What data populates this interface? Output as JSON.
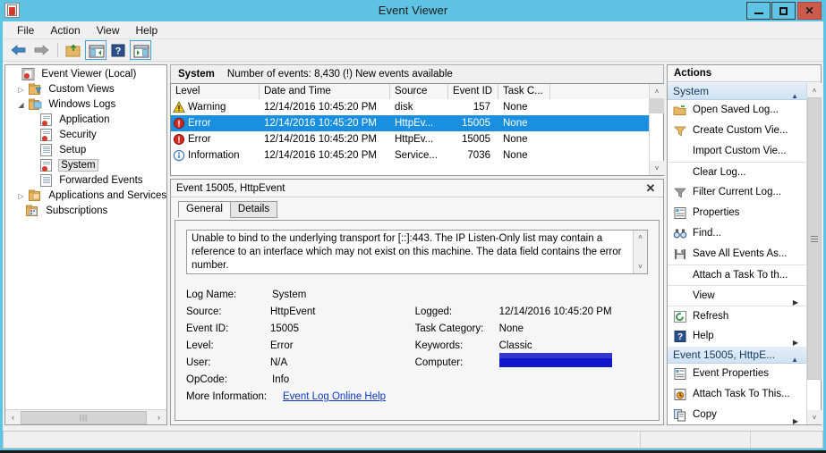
{
  "window": {
    "title": "Event Viewer",
    "icon": "event-viewer-icon",
    "minimize": "—",
    "maximize": "□",
    "close": "✕"
  },
  "menu": {
    "items": [
      {
        "label": "File"
      },
      {
        "label": "Action"
      },
      {
        "label": "View"
      },
      {
        "label": "Help"
      }
    ]
  },
  "toolbar": {
    "buttons": [
      {
        "name": "back-button",
        "icon": "left-arrow-icon"
      },
      {
        "name": "forward-button",
        "icon": "right-arrow-icon"
      },
      {
        "name": "up-one-level-button",
        "icon": "folder-up-icon"
      },
      {
        "name": "show-hide-console-tree-button",
        "icon": "console-tree-icon"
      },
      {
        "name": "help-button",
        "icon": "question-mark-icon"
      },
      {
        "name": "show-hide-action-pane-button",
        "icon": "action-pane-icon"
      }
    ]
  },
  "tree": {
    "nodes": [
      {
        "label": "Event Viewer (Local)",
        "indent": 0,
        "expander": "",
        "icon": "event-viewer-icon",
        "selected": false
      },
      {
        "label": "Custom Views",
        "indent": 1,
        "expander": "▷",
        "icon": "custom-views-icon",
        "selected": false
      },
      {
        "label": "Windows Logs",
        "indent": 1,
        "expander": "◢",
        "icon": "windows-logs-icon",
        "selected": false
      },
      {
        "label": "Application",
        "indent": 2,
        "expander": "",
        "icon": "log-alert-icon",
        "selected": false
      },
      {
        "label": "Security",
        "indent": 2,
        "expander": "",
        "icon": "log-alert-icon",
        "selected": false
      },
      {
        "label": "Setup",
        "indent": 2,
        "expander": "",
        "icon": "log-icon",
        "selected": false
      },
      {
        "label": "System",
        "indent": 2,
        "expander": "",
        "icon": "log-alert-icon",
        "selected": true
      },
      {
        "label": "Forwarded Events",
        "indent": 2,
        "expander": "",
        "icon": "log-icon",
        "selected": false
      },
      {
        "label": "Applications and Services Lo",
        "indent": 1,
        "expander": "▷",
        "icon": "folder-icon",
        "selected": false
      },
      {
        "label": "Subscriptions",
        "indent": 1,
        "expander": "",
        "icon": "subscriptions-icon",
        "selected": false
      }
    ]
  },
  "log": {
    "name": "System",
    "status": "Number of events: 8,430 (!) New events available",
    "columns": [
      {
        "label": "Level"
      },
      {
        "label": "Date and Time"
      },
      {
        "label": "Source"
      },
      {
        "label": "Event ID"
      },
      {
        "label": "Task C..."
      },
      {
        "label": ""
      }
    ],
    "rows": [
      {
        "level": "Warning",
        "level_icon": "warning-icon",
        "date": "12/14/2016 10:45:20 PM",
        "source": "disk",
        "event_id": "157",
        "task": "None",
        "selected": false
      },
      {
        "level": "Error",
        "level_icon": "error-icon",
        "date": "12/14/2016 10:45:20 PM",
        "source": "HttpEv...",
        "event_id": "15005",
        "task": "None",
        "selected": true
      },
      {
        "level": "Error",
        "level_icon": "error-icon",
        "date": "12/14/2016 10:45:20 PM",
        "source": "HttpEv...",
        "event_id": "15005",
        "task": "None",
        "selected": false
      },
      {
        "level": "Information",
        "level_icon": "information-icon",
        "date": "12/14/2016 10:45:20 PM",
        "source": "Service...",
        "event_id": "7036",
        "task": "None",
        "selected": false
      }
    ]
  },
  "detail": {
    "title": "Event 15005, HttpEvent",
    "close": "✕",
    "tabs": [
      {
        "label": "General",
        "active": true
      },
      {
        "label": "Details",
        "active": false
      }
    ],
    "message": "Unable to bind to the underlying transport for [::]:443. The IP Listen-Only list may contain a reference to an interface which may not exist on this machine.  The data field contains the error number.",
    "fields": {
      "log_name_label": "Log Name:",
      "log_name_value": "System",
      "source_label": "Source:",
      "source_value": "HttpEvent",
      "logged_label": "Logged:",
      "logged_value": "12/14/2016 10:45:20 PM",
      "event_id_label": "Event ID:",
      "event_id_value": "15005",
      "task_category_label": "Task Category:",
      "task_category_value": "None",
      "level_label": "Level:",
      "level_value": "Error",
      "keywords_label": "Keywords:",
      "keywords_value": "Classic",
      "user_label": "User:",
      "user_value": "N/A",
      "computer_label": "Computer:",
      "computer_value": "",
      "opcode_label": "OpCode:",
      "opcode_value": "Info",
      "more_information_label": "More Information:",
      "more_information_link": "Event Log Online Help"
    }
  },
  "actions": {
    "title": "Actions",
    "sections": [
      {
        "header": "System",
        "caret": "▲",
        "items": [
          {
            "label": "Open Saved Log...",
            "icon": "open-folder-icon",
            "divider": false,
            "submenu": ""
          },
          {
            "label": "Create Custom Vie...",
            "icon": "filter-icon",
            "divider": false,
            "submenu": ""
          },
          {
            "label": "Import Custom Vie...",
            "icon": "",
            "divider": false,
            "submenu": ""
          },
          {
            "label": "Clear Log...",
            "icon": "",
            "divider": true,
            "submenu": ""
          },
          {
            "label": "Filter Current Log...",
            "icon": "filter-icon",
            "divider": false,
            "submenu": ""
          },
          {
            "label": "Properties",
            "icon": "properties-icon",
            "divider": false,
            "submenu": ""
          },
          {
            "label": "Find...",
            "icon": "binoculars-icon",
            "divider": false,
            "submenu": ""
          },
          {
            "label": "Save All Events As...",
            "icon": "save-icon",
            "divider": false,
            "submenu": ""
          },
          {
            "label": "Attach a Task To th...",
            "icon": "",
            "divider": true,
            "submenu": ""
          },
          {
            "label": "View",
            "icon": "",
            "divider": true,
            "submenu": "▶"
          },
          {
            "label": "Refresh",
            "icon": "refresh-icon",
            "divider": true,
            "submenu": ""
          },
          {
            "label": "Help",
            "icon": "question-mark-icon",
            "divider": false,
            "submenu": "▶"
          }
        ]
      },
      {
        "header": "Event 15005, HttpE...",
        "caret": "▲",
        "items": [
          {
            "label": "Event Properties",
            "icon": "properties-icon",
            "divider": false,
            "submenu": ""
          },
          {
            "label": "Attach Task To This...",
            "icon": "attach-task-icon",
            "divider": false,
            "submenu": ""
          },
          {
            "label": "Copy",
            "icon": "copy-icon",
            "divider": false,
            "submenu": "▶"
          }
        ]
      }
    ]
  },
  "scrollbars": {
    "up_arrow": "˄",
    "down_arrow": "˅",
    "left_arrow": "‹",
    "right_arrow": "›",
    "grip": "|||"
  },
  "statusbar": {
    "segments": [
      "",
      "",
      ""
    ]
  },
  "colors": {
    "window_frame": "#5FC3E4",
    "selection_blue": "#1a8fe0",
    "close_button_red": "#cc5b4e",
    "link_blue": "#0b37c9",
    "redaction_blue": "#1015c9",
    "error_red": "#d93b2b",
    "warning_yellow": "#f5c518",
    "info_blue": "#2f6fb5"
  }
}
